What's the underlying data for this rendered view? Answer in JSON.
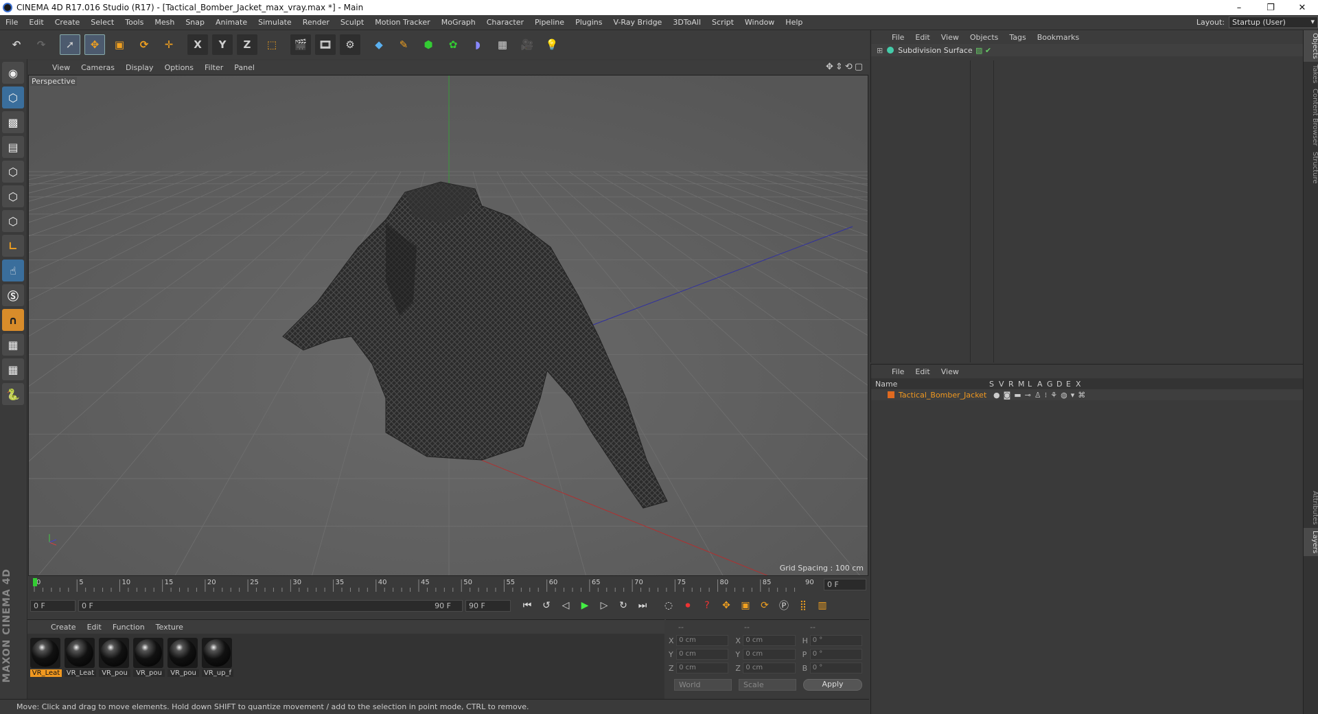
{
  "window": {
    "title": "CINEMA 4D R17.016 Studio (R17) - [Tactical_Bomber_Jacket_max_vray.max *] - Main",
    "min": "–",
    "max": "❐",
    "close": "✕"
  },
  "menubar": {
    "items": [
      "File",
      "Edit",
      "Create",
      "Select",
      "Tools",
      "Mesh",
      "Snap",
      "Animate",
      "Simulate",
      "Render",
      "Sculpt",
      "Motion Tracker",
      "MoGraph",
      "Character",
      "Pipeline",
      "Plugins",
      "V-Ray Bridge",
      "3DToAll",
      "Script",
      "Window",
      "Help"
    ],
    "layout_label": "Layout:",
    "layout_value": "Startup (User)"
  },
  "toolbar": {
    "x_label": "X",
    "y_label": "Y",
    "z_label": "Z"
  },
  "viewport": {
    "menu": [
      "View",
      "Cameras",
      "Display",
      "Options",
      "Filter",
      "Panel"
    ],
    "label": "Perspective",
    "grid_spacing": "Grid Spacing : 100 cm"
  },
  "timeline": {
    "ticks": [
      "0",
      "5",
      "10",
      "15",
      "20",
      "25",
      "30",
      "35",
      "40",
      "45",
      "50",
      "55",
      "60",
      "65",
      "70",
      "75",
      "80",
      "85",
      "90"
    ],
    "frame_current": "0 F",
    "start": "0 F",
    "range_start": "0 F",
    "range_end": "90 F",
    "end": "90 F"
  },
  "materials": {
    "menu": [
      "Create",
      "Edit",
      "Function",
      "Texture"
    ],
    "items": [
      "VR_Leat",
      "VR_Leat",
      "VR_pou",
      "VR_pou",
      "VR_pou",
      "VR_up_f"
    ]
  },
  "coords": {
    "header": [
      "--",
      "--",
      "--"
    ],
    "rows": [
      {
        "a": "X",
        "v1": "0 cm",
        "b": "X",
        "v2": "0 cm",
        "c": "H",
        "v3": "0 °"
      },
      {
        "a": "Y",
        "v1": "0 cm",
        "b": "Y",
        "v2": "0 cm",
        "c": "P",
        "v3": "0 °"
      },
      {
        "a": "Z",
        "v1": "0 cm",
        "b": "Z",
        "v2": "0 cm",
        "c": "B",
        "v3": "0 °"
      }
    ],
    "world": "World",
    "scale": "Scale",
    "apply": "Apply"
  },
  "status": "Move: Click and drag to move elements. Hold down SHIFT to quantize movement / add to the selection in point mode, CTRL to remove.",
  "objects": {
    "menu": [
      "File",
      "Edit",
      "View",
      "Objects",
      "Tags",
      "Bookmarks"
    ],
    "item": "Subdivision Surface"
  },
  "layers": {
    "menu": [
      "File",
      "Edit",
      "View"
    ],
    "name_col": "Name",
    "cols": [
      "S",
      "V",
      "R",
      "M",
      "L",
      "A",
      "G",
      "D",
      "E",
      "X"
    ],
    "item": "Tactical_Bomber_Jacket"
  },
  "side_tabs": [
    "Objects",
    "Takes",
    "Content Browser",
    "Structure",
    "Attributes",
    "Layers"
  ],
  "logo_text": "MAXON CINEMA 4D"
}
